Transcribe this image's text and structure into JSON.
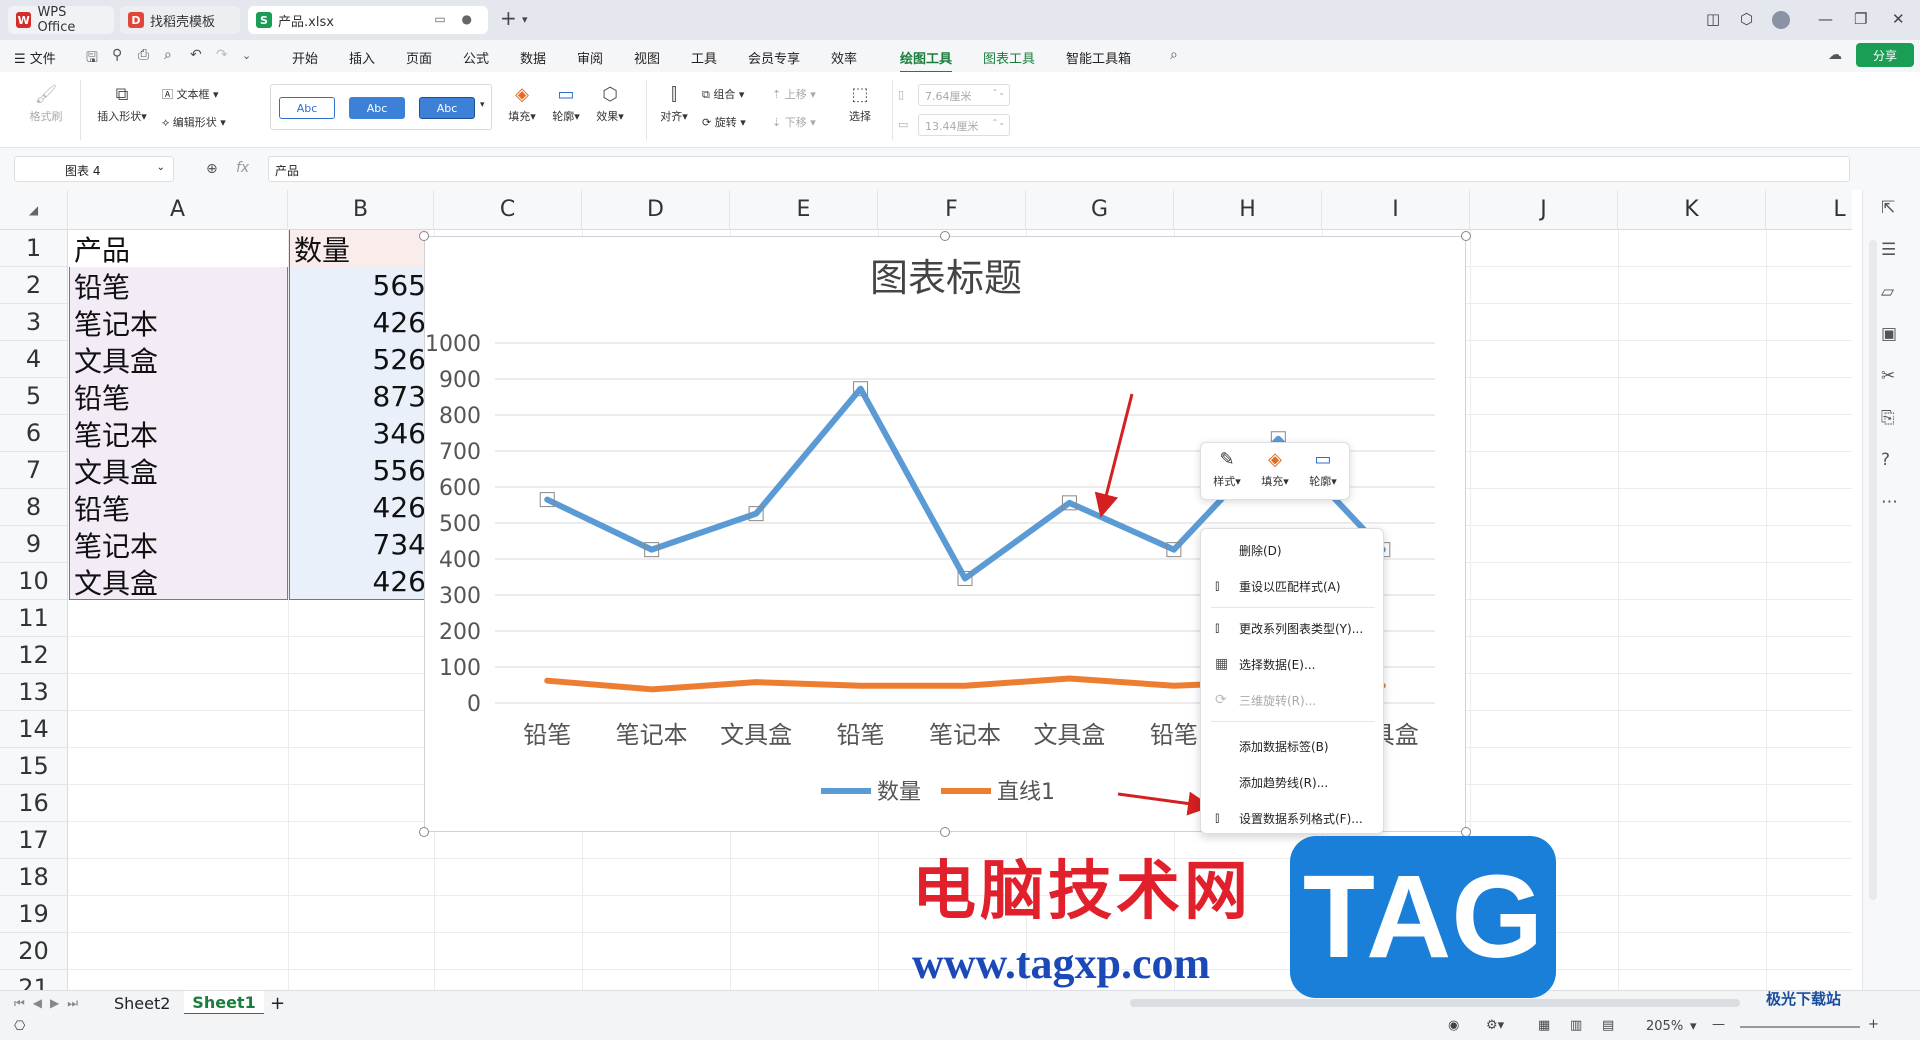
{
  "titlebar": {
    "tabs": [
      {
        "label": "WPS Office"
      },
      {
        "label": "找稻壳模板"
      },
      {
        "label": "产品.xlsx"
      }
    ],
    "new_tab": "+"
  },
  "menubar": {
    "file": "☰ 文件",
    "items": [
      "开始",
      "插入",
      "页面",
      "公式",
      "数据",
      "审阅",
      "视图",
      "工具",
      "会员专享",
      "效率",
      "绘图工具",
      "图表工具",
      "智能工具箱"
    ],
    "share": "分享"
  },
  "ribbon": {
    "format_painter": "格式刷",
    "insert_shape": "插入形状",
    "textbox": "文本框",
    "edit_shape": "编辑形状",
    "style_sample": "Abc",
    "fill": "填充",
    "outline": "轮廓",
    "effect": "效果",
    "align": "对齐",
    "group": "组合",
    "rotate": "旋转",
    "bring_up": "上移",
    "send_down": "下移",
    "select": "选择",
    "height": "7.64厘米",
    "width": "13.44厘米"
  },
  "formulabar": {
    "namebox": "图表 4",
    "fx": "fx",
    "content": "产品"
  },
  "columns": [
    "A",
    "B",
    "C",
    "D",
    "E",
    "F",
    "G",
    "H",
    "I",
    "J",
    "K",
    "L"
  ],
  "rows": [
    "1",
    "2",
    "3",
    "4",
    "5",
    "6",
    "7",
    "8",
    "9",
    "10",
    "11",
    "12",
    "13",
    "14",
    "15",
    "16",
    "17",
    "18",
    "19",
    "20",
    "21"
  ],
  "cells": [
    {
      "a": "产品",
      "b": "数量"
    },
    {
      "a": "铅笔",
      "b": "565"
    },
    {
      "a": "笔记本",
      "b": "426"
    },
    {
      "a": "文具盒",
      "b": "526"
    },
    {
      "a": "铅笔",
      "b": "873"
    },
    {
      "a": "笔记本",
      "b": "346"
    },
    {
      "a": "文具盒",
      "b": "556"
    },
    {
      "a": "铅笔",
      "b": "426"
    },
    {
      "a": "笔记本",
      "b": "734"
    },
    {
      "a": "文具盒",
      "b": "426"
    }
  ],
  "chart_data": {
    "type": "line",
    "title": "图表标题",
    "categories": [
      "铅笔",
      "笔记本",
      "文具盒",
      "铅笔",
      "笔记本",
      "文具盒",
      "铅笔",
      "笔记本",
      "文具盒"
    ],
    "series": [
      {
        "name": "数量",
        "values": [
          565,
          426,
          526,
          873,
          346,
          556,
          426,
          734,
          426
        ],
        "color": "#5b9bd5"
      },
      {
        "name": "直线1",
        "values": [
          62,
          38,
          58,
          48,
          48,
          68,
          48,
          60,
          48
        ],
        "color": "#ed7d31"
      }
    ],
    "yticks": [
      "0",
      "100",
      "200",
      "300",
      "400",
      "500",
      "600",
      "700",
      "800",
      "900",
      "1000"
    ],
    "ylim": [
      0,
      1000
    ],
    "grid": true,
    "legend": "bottom"
  },
  "minibar": {
    "style": "样式",
    "fill": "填充",
    "outline": "轮廓"
  },
  "context_menu": {
    "items": [
      {
        "label": "删除(D)"
      },
      {
        "label": "重设以匹配样式(A)"
      },
      {
        "label": "更改系列图表类型(Y)..."
      },
      {
        "label": "选择数据(E)..."
      },
      {
        "label": "三维旋转(R)..."
      },
      {
        "label": "添加数据标签(B)"
      },
      {
        "label": "添加趋势线(R)..."
      },
      {
        "label": "设置数据系列格式(F)..."
      }
    ]
  },
  "sheets": [
    "Sheet2",
    "Sheet1"
  ],
  "status": {
    "zoom": "205%"
  },
  "watermark": {
    "cn": "电脑技术网",
    "url": "www.tagxp.com",
    "tag": "TAG",
    "corner": "极光下载站"
  },
  "colors": {
    "accent": "#1a7f3c",
    "series1": "#5b9bd5",
    "series2": "#ed7d31",
    "arrow": "#d42020"
  }
}
